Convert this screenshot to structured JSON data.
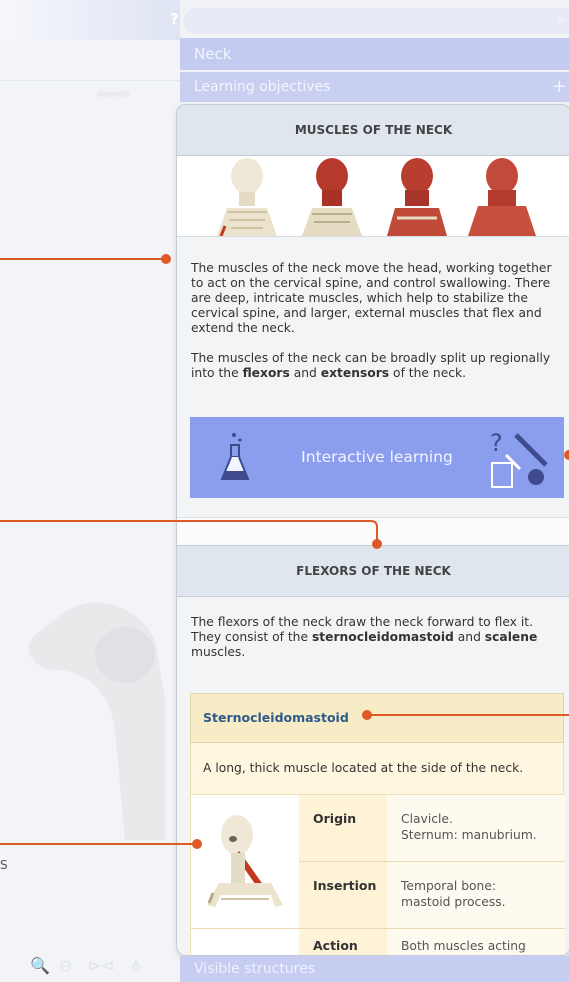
{
  "toolbar": {
    "help_label": "?"
  },
  "panel": {
    "title": "Neck",
    "learning_objectives": "Learning objectives",
    "learning_objectives_toggle": "+",
    "visible_structures": "Visible structures"
  },
  "muscles_section": {
    "title": "MUSCLES OF THE NECK",
    "para1": "The muscles of the neck move the head, working together to act on the cervical spine, and control swallowing. There are deep, intricate muscles, which help to stabilize the cervical spine, and larger, external muscles that flex and extend the neck.",
    "para2_start": "The muscles of the neck can be broadly split up regionally into the ",
    "flexors_bold": "flexors",
    "para2_mid": " and ",
    "extensors_bold": "extensors",
    "para2_end": " of the neck.",
    "interactive_label": "Interactive learning"
  },
  "flexors_section": {
    "title": "FLEXORS OF THE NECK",
    "para_start": "The flexors of the neck draw the neck forward to flex it. They consist of the ",
    "scm_bold": "sternocleidomastoid",
    "para_mid": " and ",
    "scalene_bold": "scalene",
    "para_end": " muscles."
  },
  "sternocleidomastoid": {
    "name": "Sternocleidomastoid",
    "description": "A long, thick muscle located at the side of the neck.",
    "rows": [
      {
        "label": "Origin",
        "value_line1": "Clavicle.",
        "value_line2": "Sternum: manubrium."
      },
      {
        "label": "Insertion",
        "value_line1": "Temporal bone:",
        "value_line2": "mastoid process."
      },
      {
        "label": "Action",
        "value_line1": "Both muscles acting",
        "value_line2": ""
      }
    ]
  },
  "left_stub": {
    "text": "S"
  },
  "colors": {
    "accent": "#dd5a26",
    "banner": "#8b9eed",
    "header_bg": "#dfe6ee",
    "highlight": "#f7ecc6",
    "link": "#2e5a8a"
  },
  "icons": [
    "help-icon",
    "search-icon",
    "arrow-left-icon",
    "arrow-right-icon",
    "flask-icon",
    "interactive-tools-icon",
    "zoom-in-icon",
    "zoom-out-icon",
    "mirror-icon",
    "hierarchy-icon"
  ]
}
